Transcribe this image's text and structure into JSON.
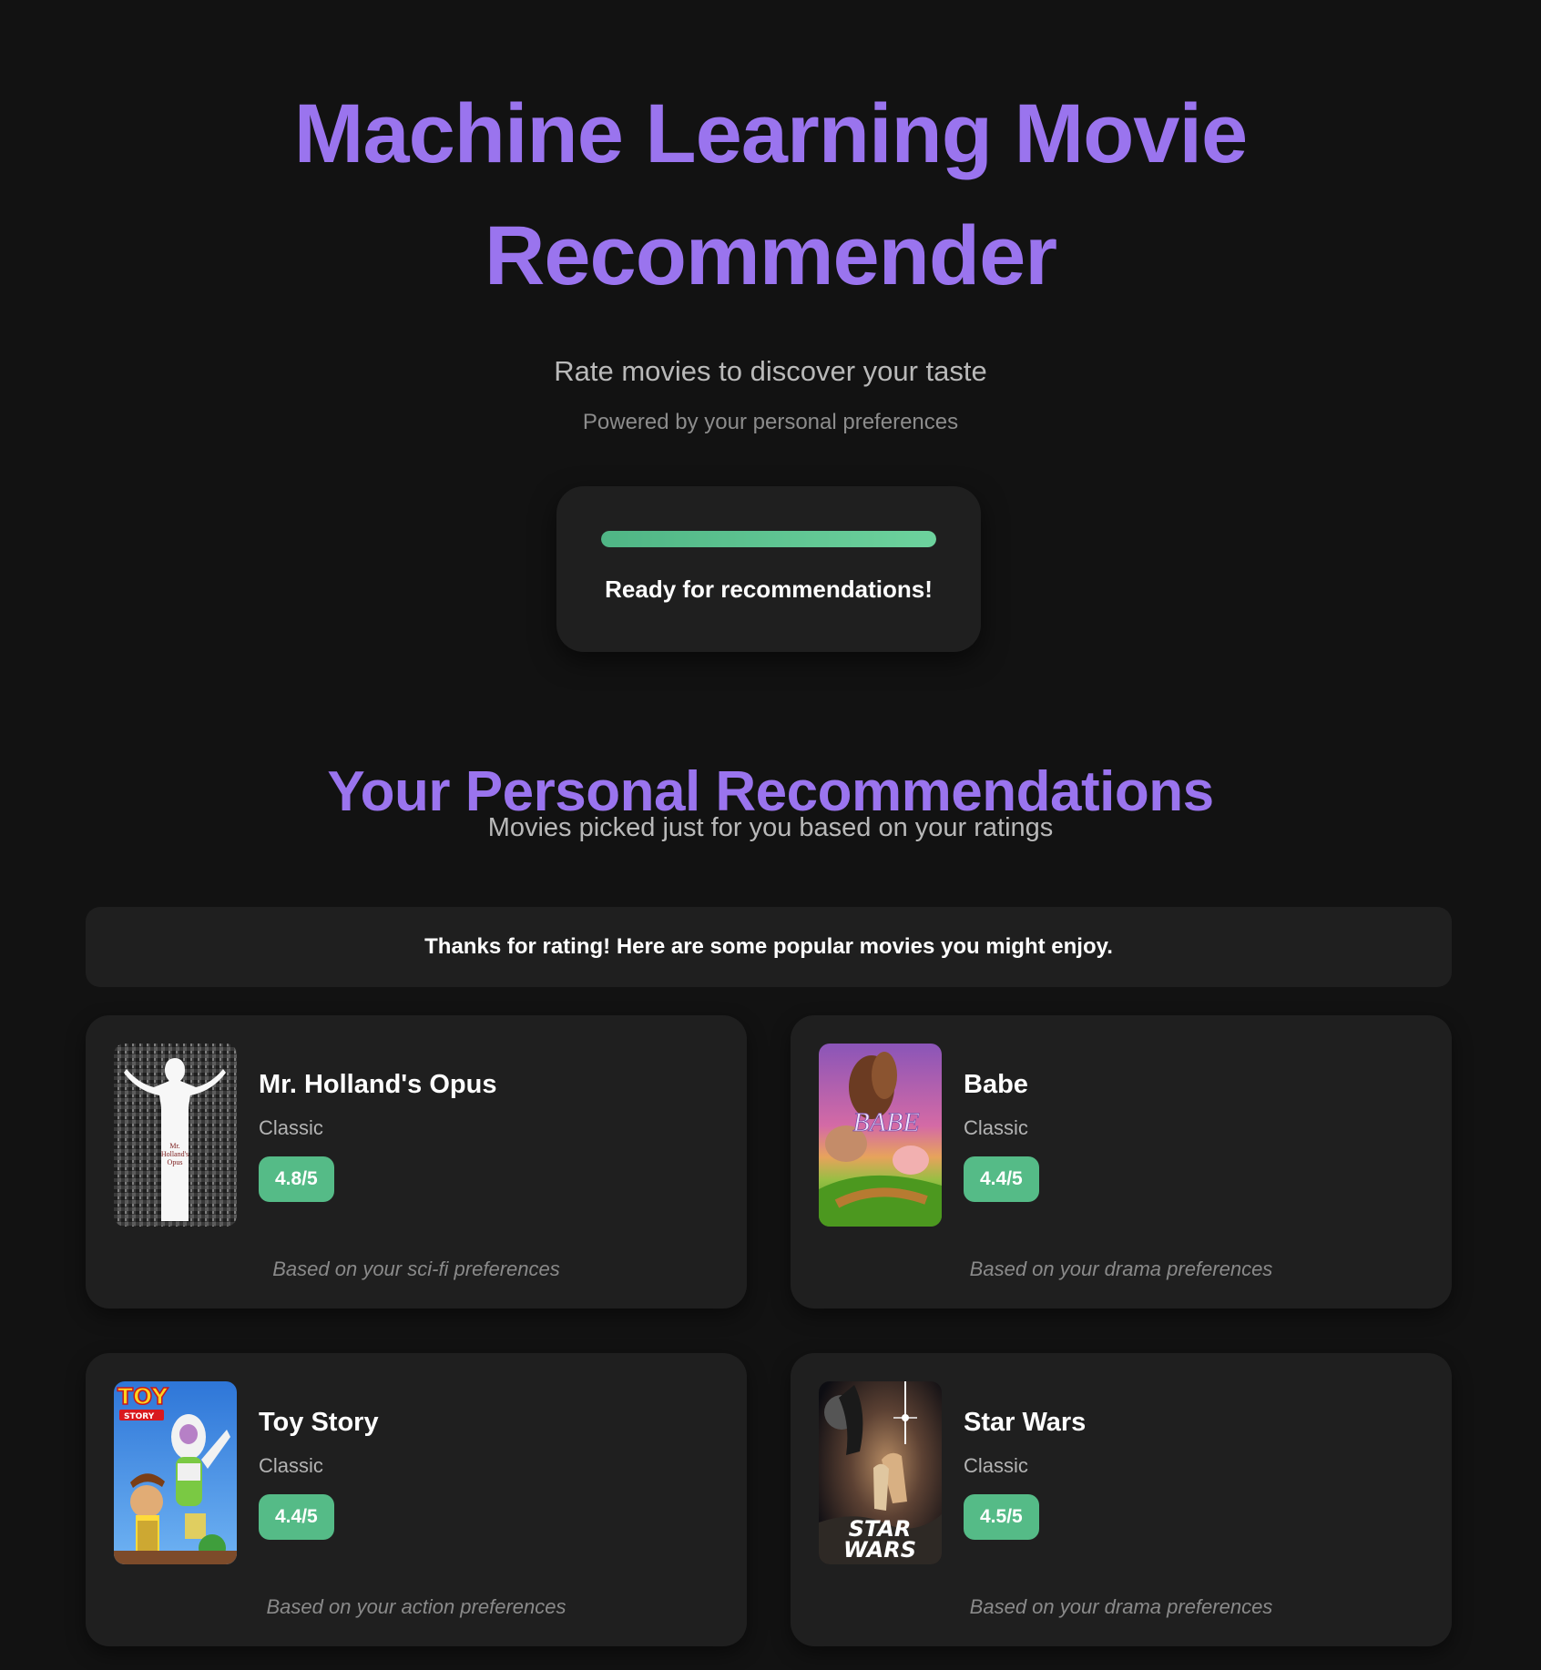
{
  "header": {
    "title": "Machine Learning Movie Recommender",
    "subtitle": "Rate movies to discover your taste",
    "powered_by": "Powered by your personal preferences"
  },
  "status": {
    "message": "Ready for recommendations!",
    "progress_percent": 100,
    "progress_color": "#5fc490"
  },
  "recommendations": {
    "title": "Your Personal Recommendations",
    "subtitle": "Movies picked just for you based on your ratings",
    "notice": "Thanks for rating! Here are some popular movies you might enjoy.",
    "movies": [
      {
        "title": "Mr. Holland's Opus",
        "genre": "Classic",
        "rating": "4.8/5",
        "reason": "Based on your sci-fi preferences"
      },
      {
        "title": "Babe",
        "genre": "Classic",
        "rating": "4.4/5",
        "reason": "Based on your drama preferences"
      },
      {
        "title": "Toy Story",
        "genre": "Classic",
        "rating": "4.4/5",
        "reason": "Based on your action preferences"
      },
      {
        "title": "Star Wars",
        "genre": "Classic",
        "rating": "4.5/5",
        "reason": "Based on your drama preferences"
      }
    ]
  },
  "colors": {
    "accent": "#9a74ee",
    "success": "#55bb87",
    "background": "#121212",
    "card": "#1f1f1f"
  }
}
